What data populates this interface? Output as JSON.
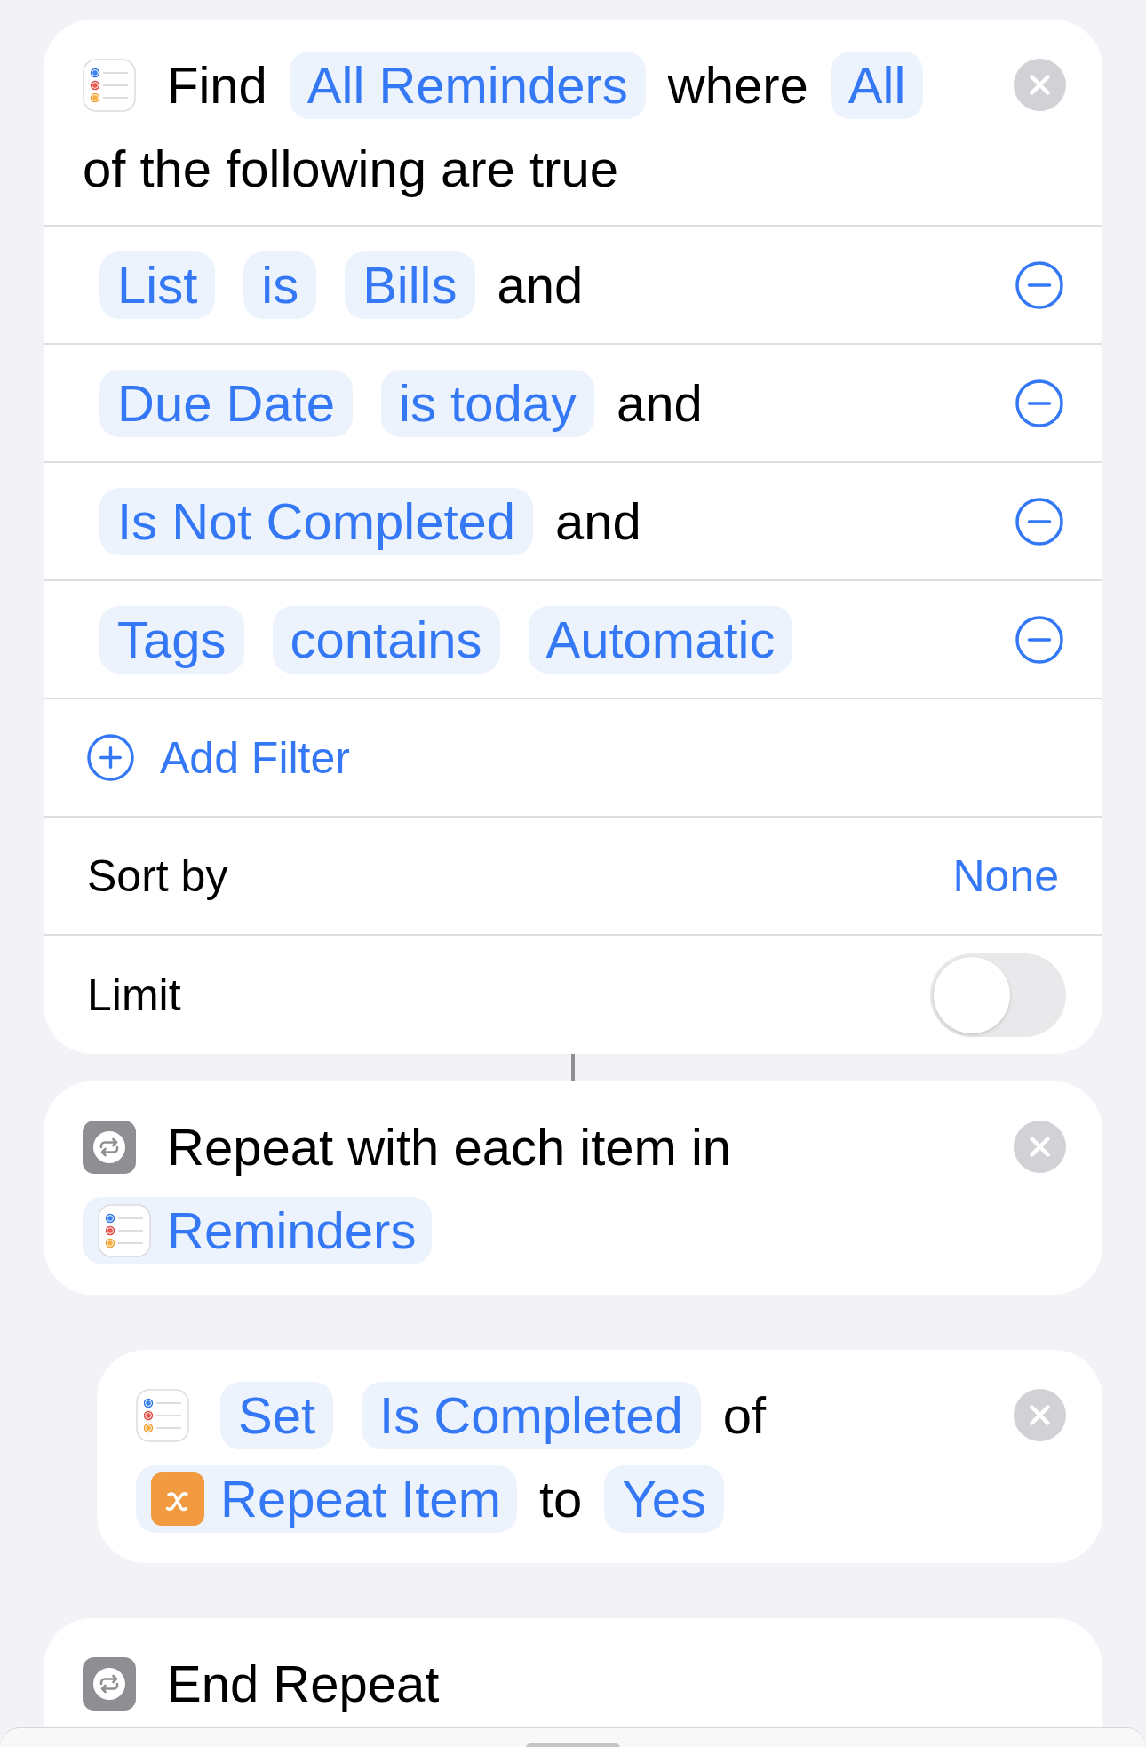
{
  "actions": [
    {
      "kind": "find",
      "removable": true,
      "linked_to_next": true,
      "parts": [
        {
          "kind": "text",
          "text": "Find"
        },
        {
          "kind": "token",
          "text": "All Reminders"
        },
        {
          "kind": "text",
          "text": "where"
        },
        {
          "kind": "token",
          "text": "All"
        },
        {
          "kind": "text",
          "text": "of the following are true"
        }
      ],
      "filters": [
        {
          "parts": [
            {
              "kind": "token",
              "text": "List"
            },
            {
              "kind": "token",
              "text": "is"
            },
            {
              "kind": "token",
              "text": "Bills"
            },
            {
              "kind": "text",
              "text": "and"
            }
          ]
        },
        {
          "parts": [
            {
              "kind": "token",
              "text": "Due Date"
            },
            {
              "kind": "token",
              "text": "is today"
            },
            {
              "kind": "text",
              "text": "and"
            }
          ]
        },
        {
          "parts": [
            {
              "kind": "token",
              "text": "Is Not Completed"
            },
            {
              "kind": "text",
              "text": "and"
            }
          ]
        },
        {
          "parts": [
            {
              "kind": "token",
              "text": "Tags"
            },
            {
              "kind": "token",
              "text": "contains"
            },
            {
              "kind": "token",
              "text": "Automatic"
            }
          ]
        }
      ],
      "add_filter": "Add Filter",
      "sort": {
        "label": "Sort by",
        "value": "None"
      },
      "limit": {
        "label": "Limit",
        "on": false
      }
    },
    {
      "kind": "repeat",
      "removable": true,
      "linked_to_next": false,
      "parts": [
        {
          "kind": "text",
          "text": "Repeat with each item in"
        },
        {
          "kind": "output",
          "text": "Reminders"
        }
      ],
      "children": [
        {
          "kind": "set",
          "removable": true,
          "linked_to_next": false,
          "parts": [
            {
              "kind": "token",
              "text": "Set"
            },
            {
              "kind": "token",
              "text": "Is Completed"
            },
            {
              "kind": "text",
              "text": "of"
            },
            {
              "kind": "variable",
              "text": "Repeat Item"
            },
            {
              "kind": "text",
              "text": "to"
            },
            {
              "kind": "token",
              "text": "Yes"
            }
          ]
        }
      ]
    },
    {
      "kind": "end_repeat",
      "removable": false,
      "linked_to_next": false,
      "parts": [
        {
          "kind": "text",
          "text": "End Repeat"
        }
      ]
    }
  ]
}
